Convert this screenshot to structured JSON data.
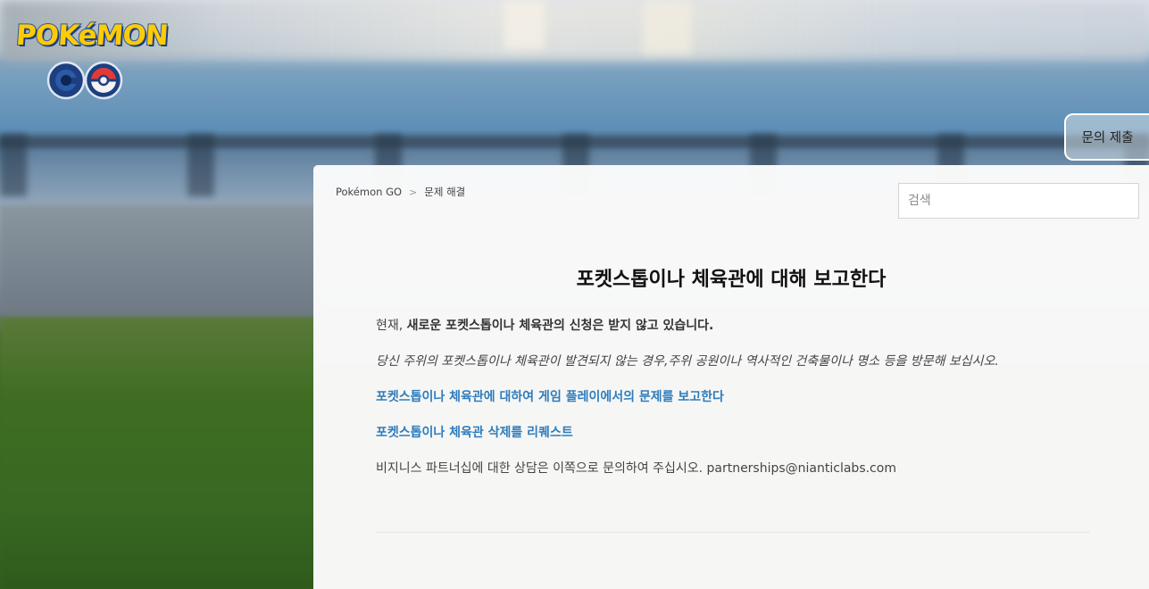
{
  "logo": {
    "word": "POKéMON",
    "go": "GO"
  },
  "header": {
    "submit_label": "문의 제출"
  },
  "breadcrumb": {
    "items": [
      "Pokémon GO",
      "문제 해결"
    ],
    "separator": ">"
  },
  "search": {
    "placeholder": "검색"
  },
  "article": {
    "title": "포켓스톱이나 체육관에 대해 보고한다",
    "para1_lead": "현재,",
    "para1_bold": "새로운 포켓스톱이나 체육관의 신청은 받지 않고 있습니다.",
    "para2": "당신 주위의 포켓스톱이나 체육관이 발견되지 않는 경우,주위 공원이나 역사적인 건축물이나 명소 등을 방문해 보십시오.",
    "link1": "포켓스톱이나 체육관에 대하여 게임 플레이에서의 문제를 보고한다",
    "link2": "포켓스톱이나 체육관 삭제를 리퀘스트",
    "para3": "비지니스 파트너십에 대한 상담은 이쪽으로 문의하여 주십시오. partnerships@nianticlabs.com"
  },
  "colors": {
    "link": "#2f7cbc",
    "logo_yellow": "#ffcb05",
    "logo_blue": "#2a5aa8"
  }
}
